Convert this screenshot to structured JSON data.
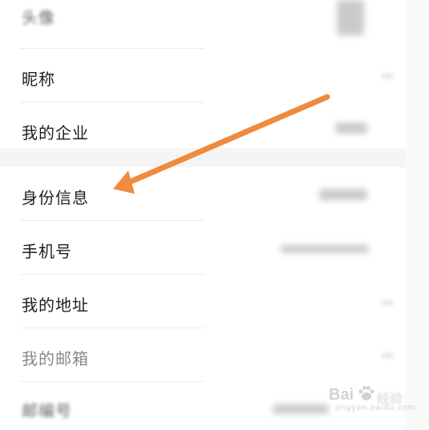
{
  "settings_list": {
    "rows": [
      {
        "label": "头像"
      },
      {
        "label": "昵称"
      },
      {
        "label": "我的企业"
      },
      {
        "label": "身份信息"
      },
      {
        "label": "手机号"
      },
      {
        "label": "我的地址"
      },
      {
        "label": "我的邮箱"
      },
      {
        "label": "邮编号"
      }
    ]
  },
  "annotation": {
    "arrow_color": "#f08a3c",
    "points_to": "身份信息"
  },
  "watermark": {
    "brand": "Bai",
    "brand_tail": "du",
    "suffix": "经验",
    "url": "jingyan.baidu.com"
  }
}
